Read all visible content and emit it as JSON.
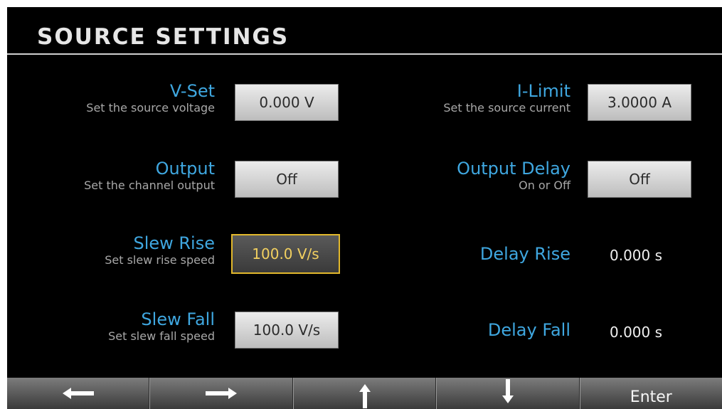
{
  "title": "SOURCE SETTINGS",
  "left": [
    {
      "label": "V-Set",
      "sub": "Set the source voltage",
      "value": "0.000 V"
    },
    {
      "label": "Output",
      "sub": "Set the channel output",
      "value": "Off"
    },
    {
      "label": "Slew Rise",
      "sub": "Set slew rise speed",
      "value": "100.0 V/s"
    },
    {
      "label": "Slew Fall",
      "sub": "Set slew fall speed",
      "value": "100.0 V/s"
    }
  ],
  "right": [
    {
      "label": "I-Limit",
      "sub": "Set the source current",
      "value": "3.0000 A"
    },
    {
      "label": "Output Delay",
      "sub": "On or Off",
      "value": "Off"
    },
    {
      "label": "Delay Rise",
      "value": "0.000 s"
    },
    {
      "label": "Delay Fall",
      "value": "0.000 s"
    }
  ],
  "softkeys": {
    "left_icon": "arrow-left-icon",
    "right_icon": "arrow-right-icon",
    "up_icon": "arrow-up-icon",
    "down_icon": "arrow-down-icon",
    "enter_label": "Enter"
  },
  "colors": {
    "label": "#3fa7e0",
    "focus_border": "#e2b82c",
    "focus_text": "#f2d060"
  }
}
